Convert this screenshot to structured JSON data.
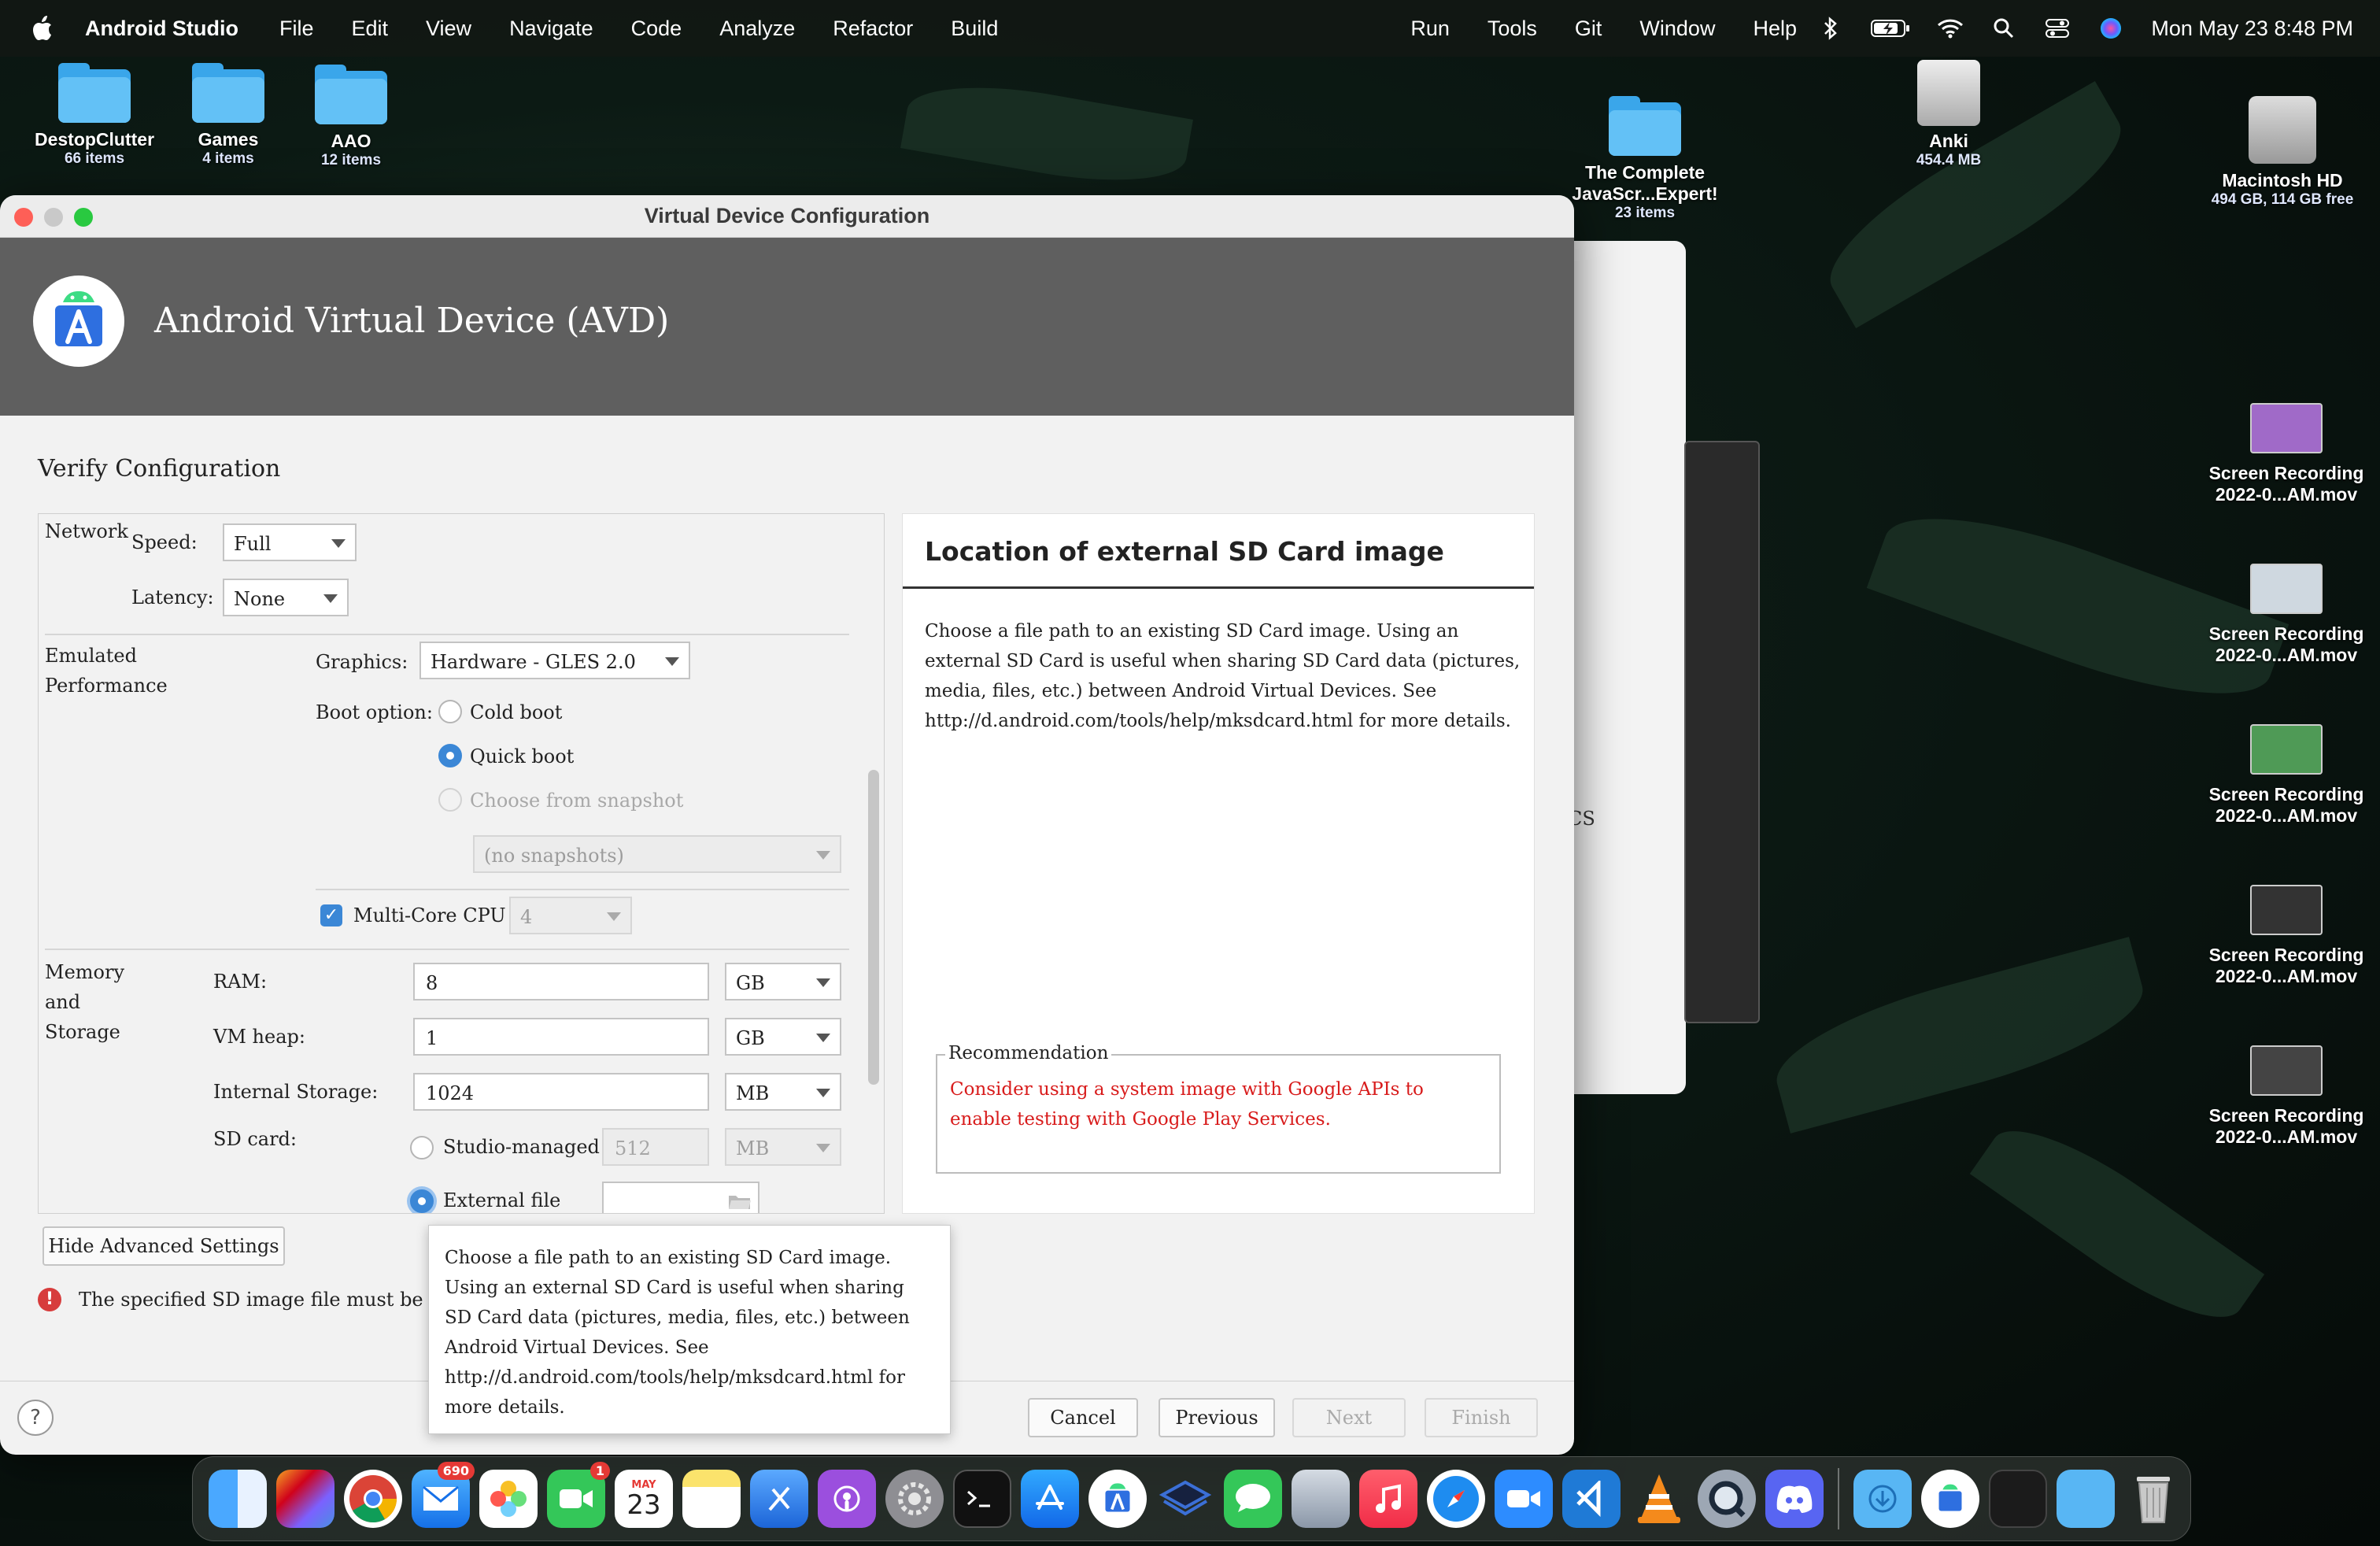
{
  "menubar": {
    "app_name": "Android Studio",
    "menus": [
      "File",
      "Edit",
      "View",
      "Navigate",
      "Code",
      "Analyze",
      "Refactor",
      "Build",
      "Run",
      "Tools",
      "Git",
      "Window",
      "Help"
    ],
    "clock": "Mon May 23  8:48 PM"
  },
  "desktop": {
    "icons": [
      {
        "name": "DestopClutter",
        "sub": "66 items"
      },
      {
        "name": "Games",
        "sub": "4 items"
      },
      {
        "name": "AAO",
        "sub": "12 items"
      },
      {
        "name": "The Complete\nJavaScr...Expert!",
        "sub": "23 items"
      },
      {
        "name": "Anki",
        "sub": "454.4 MB"
      },
      {
        "name": "Macintosh HD",
        "sub": "494 GB, 114 GB free"
      }
    ],
    "recordings": [
      {
        "name": "Screen Recording",
        "sub": "2022-0...AM.mov"
      },
      {
        "name": "Screen Recording",
        "sub": "2022-0...AM.mov"
      },
      {
        "name": "Screen Recording",
        "sub": "2022-0...AM.mov"
      },
      {
        "name": "Screen Recording",
        "sub": "2022-0...AM.mov"
      },
      {
        "name": "Screen Recording",
        "sub": "2022-0...AM.mov"
      }
    ],
    "bg_window_fragment": "CS"
  },
  "dialog": {
    "window_title": "Virtual Device Configuration",
    "banner_title": "Android Virtual Device (AVD)",
    "section_title": "Verify Configuration",
    "network": {
      "label": "Network",
      "speed_label": "Speed:",
      "speed_value": "Full",
      "latency_label": "Latency:",
      "latency_value": "None"
    },
    "performance": {
      "label_line1": "Emulated",
      "label_line2": "Performance",
      "graphics_label": "Graphics:",
      "graphics_value": "Hardware - GLES 2.0",
      "boot_label": "Boot option:",
      "boot_options": [
        "Cold boot",
        "Quick boot",
        "Choose from snapshot"
      ],
      "boot_selected": "Quick boot",
      "snapshot_value": "(no snapshots)",
      "multicore_label": "Multi-Core CPU",
      "multicore_checked": true,
      "cores_value": "4"
    },
    "memory": {
      "label_line1": "Memory",
      "label_line2": "and",
      "label_line3": "Storage",
      "ram_label": "RAM:",
      "ram_value": "8",
      "ram_unit": "GB",
      "heap_label": "VM heap:",
      "heap_value": "1",
      "heap_unit": "GB",
      "storage_label": "Internal Storage:",
      "storage_value": "1024",
      "storage_unit": "MB",
      "sd_label": "SD card:",
      "sd_managed_label": "Studio-managed",
      "sd_managed_value": "512",
      "sd_managed_unit": "MB",
      "sd_external_label": "External file",
      "sd_external_value": ""
    },
    "hide_advanced_button": "Hide Advanced Settings",
    "error_text": "The specified SD image file must be a vali",
    "help_panel": {
      "title": "Location of external SD Card image",
      "description": "Choose a file path to an existing SD Card image. Using an external SD Card is useful when sharing SD Card data (pictures, media, files, etc.) between Android Virtual Devices. See http://d.android.com/tools/help/mksdcard.html for more details.",
      "recommendation_legend": "Recommendation",
      "recommendation_text": "Consider using a system image with Google APIs to enable testing with Google Play Services."
    },
    "tooltip": "Choose a file path to an existing SD Card image. Using an external SD Card is useful when sharing SD Card data (pictures, media, files, etc.) between Android Virtual Devices. See http://d.android.com/tools/help/mksdcard.html for more details.",
    "buttons": {
      "help": "?",
      "cancel": "Cancel",
      "previous": "Previous",
      "next": "Next",
      "finish": "Finish"
    }
  },
  "dock": {
    "mail_badge": "690",
    "facetime_badge": "1",
    "calendar_month": "MAY",
    "calendar_day": "23"
  },
  "colors": {
    "accent_blue": "#3b87d6",
    "error_red": "#d81b1b",
    "banner_gray": "#5f5f5f"
  }
}
